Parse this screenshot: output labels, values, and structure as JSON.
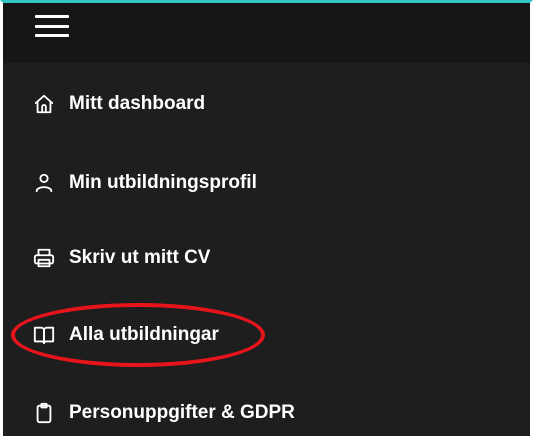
{
  "menu": {
    "items": [
      {
        "label": "Mitt dashboard",
        "icon": "home-icon"
      },
      {
        "label": "Min utbildningsprofil",
        "icon": "user-icon"
      },
      {
        "label": "Skriv ut mitt CV",
        "icon": "printer-icon"
      },
      {
        "label": "Alla utbildningar",
        "icon": "book-open-icon"
      },
      {
        "label": "Personuppgifter & GDPR",
        "icon": "clipboard-icon"
      }
    ]
  },
  "colors": {
    "background": "#1e1e1e",
    "topbar": "#161616",
    "accent_top_border": "#34c6c6",
    "highlight": "#e8141b",
    "text": "#ffffff"
  }
}
